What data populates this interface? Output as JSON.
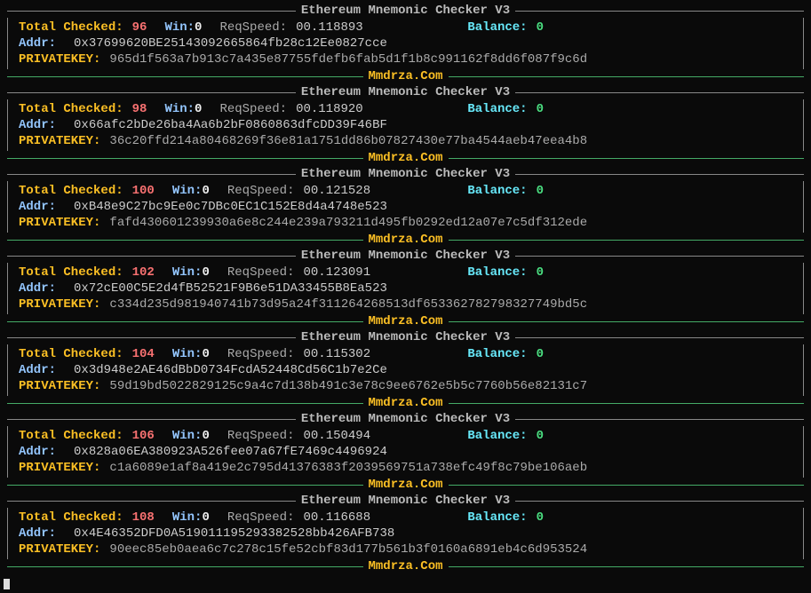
{
  "common": {
    "title": "Ethereum Mnemonic Checker V3",
    "footer": "Mmdrza.Com",
    "lbl_total": "Total Checked:",
    "lbl_win": "Win:",
    "lbl_reqspeed": "ReqSpeed:",
    "lbl_balance": "Balance:",
    "lbl_addr": "Addr:",
    "lbl_pk": "PRIVATEKEY:"
  },
  "blocks": [
    {
      "total": "96",
      "win": "0",
      "reqspeed": "00.118893",
      "balance": "0",
      "addr": "0x37699620BE25143092665864fb28c12Ee0827cce",
      "pk": "965d1f563a7b913c7a435e87755fdefb6fab5d1f1b8c991162f8dd6f087f9c6d"
    },
    {
      "total": "98",
      "win": "0",
      "reqspeed": "00.118920",
      "balance": "0",
      "addr": "0x66afc2bDe26ba4Aa6b2bF0860863dfcDD39F46BF",
      "pk": "36c20ffd214a80468269f36e81a1751dd86b07827430e77ba4544aeb47eea4b8"
    },
    {
      "total": "100",
      "win": "0",
      "reqspeed": "00.121528",
      "balance": "0",
      "addr": "0xB48e9C27bc9Ee0c7DBc0EC1C152E8d4a4748e523",
      "pk": "fafd43060123993​0a6e8c244e239a793211d495fb0292ed12a07e7c5df312ede"
    },
    {
      "total": "102",
      "win": "0",
      "reqspeed": "00.123091",
      "balance": "0",
      "addr": "0x72cE00C5E2d4fB52521F9B6e51DA33455B8Ea523",
      "pk": "c334d235d981940741b73d95a24f311264268513df653362782798327749bd5c"
    },
    {
      "total": "104",
      "win": "0",
      "reqspeed": "00.115302",
      "balance": "0",
      "addr": "0x3d948e2AE46dBbD0734FcdA52448Cd56C1b7e2Ce",
      "pk": "59d19bd5022829125c9a4c7d138b491c3e78c9ee6762e5b5c7760b56e82131c7"
    },
    {
      "total": "106",
      "win": "0",
      "reqspeed": "00.150494",
      "balance": "0",
      "addr": "0x828a06EA380923A526fee07a67fE7469c4496924",
      "pk": "c1a6089e1af8a419e2c795d41376383f2039569751a738efc49f8c79be106aeb"
    },
    {
      "total": "108",
      "win": "0",
      "reqspeed": "00.116688",
      "balance": "0",
      "addr": "0x4E46352DFD0A519011195293382528bb426AFB738",
      "pk": "90eec85eb0aea6c7c278c15fe52cbf83d177b561b3f0160a6891eb4c6d953524"
    }
  ]
}
